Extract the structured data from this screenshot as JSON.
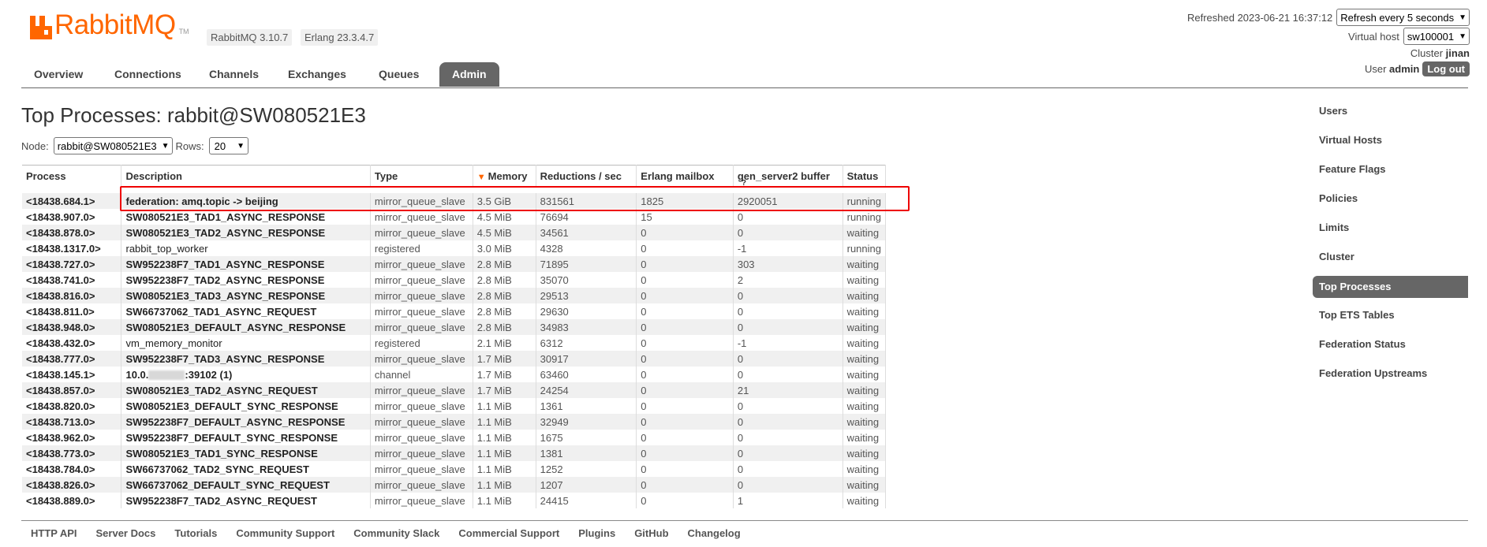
{
  "header": {
    "brand": "RabbitMQ",
    "tm": "TM",
    "version": "RabbitMQ 3.10.7",
    "erlang": "Erlang 23.3.4.7",
    "refreshed": "Refreshed 2023-06-21 16:37:12",
    "refresh_select": "Refresh every 5 seconds",
    "vhost_label": "Virtual host",
    "vhost_select": "sw100001",
    "cluster_label": "Cluster",
    "cluster": "jinan",
    "user_label": "User",
    "user": "admin",
    "logout": "Log out"
  },
  "tabs": [
    "Overview",
    "Connections",
    "Channels",
    "Exchanges",
    "Queues",
    "Admin"
  ],
  "page": {
    "title": "Top Processes: rabbit@SW080521E3",
    "node_label": "Node:",
    "node_select": "rabbit@SW080521E3",
    "rows_label": "Rows:",
    "rows_select": "20"
  },
  "table": {
    "sort_icon": "▼",
    "columns": [
      "Process",
      "Description",
      "Type",
      "Memory",
      "Reductions / sec",
      "Erlang mailbox",
      "gen_server2 buffer",
      "Status"
    ],
    "help_mark": "?",
    "rows": [
      [
        "<18438.684.1>",
        "federation: amq.topic -> beijing",
        "mirror_queue_slave",
        "3.5 GiB",
        "831561",
        "1825",
        "2920051",
        "running"
      ],
      [
        "<18438.907.0>",
        "SW080521E3_TAD1_ASYNC_RESPONSE",
        "mirror_queue_slave",
        "4.5 MiB",
        "76694",
        "15",
        "0",
        "running"
      ],
      [
        "<18438.878.0>",
        "SW080521E3_TAD2_ASYNC_RESPONSE",
        "mirror_queue_slave",
        "4.5 MiB",
        "34561",
        "0",
        "0",
        "waiting"
      ],
      [
        "<18438.1317.0>",
        "rabbit_top_worker",
        "registered",
        "3.0 MiB",
        "4328",
        "0",
        "-1",
        "running"
      ],
      [
        "<18438.727.0>",
        "SW952238F7_TAD1_ASYNC_RESPONSE",
        "mirror_queue_slave",
        "2.8 MiB",
        "71895",
        "0",
        "303",
        "waiting"
      ],
      [
        "<18438.741.0>",
        "SW952238F7_TAD2_ASYNC_RESPONSE",
        "mirror_queue_slave",
        "2.8 MiB",
        "35070",
        "0",
        "2",
        "waiting"
      ],
      [
        "<18438.816.0>",
        "SW080521E3_TAD3_ASYNC_RESPONSE",
        "mirror_queue_slave",
        "2.8 MiB",
        "29513",
        "0",
        "0",
        "waiting"
      ],
      [
        "<18438.811.0>",
        "SW66737062_TAD1_ASYNC_REQUEST",
        "mirror_queue_slave",
        "2.8 MiB",
        "29630",
        "0",
        "0",
        "waiting"
      ],
      [
        "<18438.948.0>",
        "SW080521E3_DEFAULT_ASYNC_RESPONSE",
        "mirror_queue_slave",
        "2.8 MiB",
        "34983",
        "0",
        "0",
        "waiting"
      ],
      [
        "<18438.432.0>",
        "vm_memory_monitor",
        "registered",
        "2.1 MiB",
        "6312",
        "0",
        "-1",
        "waiting"
      ],
      [
        "<18438.777.0>",
        "SW952238F7_TAD3_ASYNC_RESPONSE",
        "mirror_queue_slave",
        "1.7 MiB",
        "30917",
        "0",
        "0",
        "waiting"
      ],
      [
        "<18438.145.1>",
        "10.0.",
        "channel",
        "1.7 MiB",
        "63460",
        "0",
        "0",
        "waiting"
      ],
      [
        "<18438.857.0>",
        "SW080521E3_TAD2_ASYNC_REQUEST",
        "mirror_queue_slave",
        "1.7 MiB",
        "24254",
        "0",
        "21",
        "waiting"
      ],
      [
        "<18438.820.0>",
        "SW080521E3_DEFAULT_SYNC_RESPONSE",
        "mirror_queue_slave",
        "1.1 MiB",
        "1361",
        "0",
        "0",
        "waiting"
      ],
      [
        "<18438.713.0>",
        "SW952238F7_DEFAULT_ASYNC_RESPONSE",
        "mirror_queue_slave",
        "1.1 MiB",
        "32949",
        "0",
        "0",
        "waiting"
      ],
      [
        "<18438.962.0>",
        "SW952238F7_DEFAULT_SYNC_RESPONSE",
        "mirror_queue_slave",
        "1.1 MiB",
        "1675",
        "0",
        "0",
        "waiting"
      ],
      [
        "<18438.773.0>",
        "SW080521E3_TAD1_SYNC_RESPONSE",
        "mirror_queue_slave",
        "1.1 MiB",
        "1381",
        "0",
        "0",
        "waiting"
      ],
      [
        "<18438.784.0>",
        "SW66737062_TAD2_SYNC_REQUEST",
        "mirror_queue_slave",
        "1.1 MiB",
        "1252",
        "0",
        "0",
        "waiting"
      ],
      [
        "<18438.826.0>",
        "SW66737062_DEFAULT_SYNC_REQUEST",
        "mirror_queue_slave",
        "1.1 MiB",
        "1207",
        "0",
        "0",
        "waiting"
      ],
      [
        "<18438.889.0>",
        "SW952238F7_TAD2_ASYNC_REQUEST",
        "mirror_queue_slave",
        "1.1 MiB",
        "24415",
        "0",
        "1",
        "waiting"
      ]
    ],
    "row12_desc_suffix": ":39102 (1)"
  },
  "sidebar": [
    "Users",
    "Virtual Hosts",
    "Feature Flags",
    "Policies",
    "Limits",
    "Cluster",
    "Top Processes",
    "Top ETS Tables",
    "Federation Status",
    "Federation Upstreams"
  ],
  "sidebar_active": "Top Processes",
  "footer": [
    "HTTP API",
    "Server Docs",
    "Tutorials",
    "Community Support",
    "Community Slack",
    "Commercial Support",
    "Plugins",
    "GitHub",
    "Changelog"
  ],
  "colors": {
    "brand": "#ff6600",
    "highlight": "#e00000",
    "active": "#666666"
  }
}
